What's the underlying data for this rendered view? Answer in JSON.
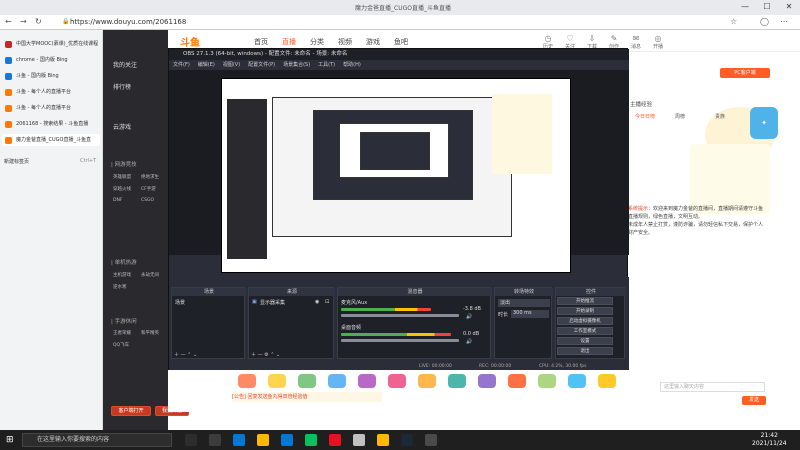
{
  "browser": {
    "window_title": "魔力金爸直播_CUGO直播_斗鱼直播",
    "url": "https://www.douyu.com/2061168",
    "minimize": "—",
    "maximize": "☐",
    "close": "✕"
  },
  "tabs": [
    {
      "label": "中国大学MOOC(慕课)_优质在线课程",
      "color": "#c62828"
    },
    {
      "label": "chrome - 国内版 Bing",
      "color": "#1976d2"
    },
    {
      "label": "斗鱼 - 国内版 Bing",
      "color": "#1976d2"
    },
    {
      "label": "斗鱼 - 每个人的直播平台",
      "color": "#ff7700"
    },
    {
      "label": "斗鱼 - 每个人的直播平台",
      "color": "#ff7700"
    },
    {
      "label": "2061168 - 搜索结果 - 斗鱼直播",
      "color": "#ff7700"
    },
    {
      "label": "魔力金爸直播_CUGO直播_斗鱼直",
      "color": "#ff7700"
    }
  ],
  "new_tab": {
    "label": "新建标签页",
    "shortcut": "Ctrl+T"
  },
  "douyu_sidebar": {
    "items": [
      "我的关注",
      "排行榜",
      "云游戏"
    ],
    "section1": "| 网游竞技",
    "section2": "| 单机热游",
    "section3": "| 手游休闲",
    "sub1": [
      "英雄联盟",
      "绝地求生",
      "穿越火线",
      "CF手游",
      "DNF",
      "CSGO"
    ],
    "sub2": [
      "主机游戏",
      "永劫无间",
      "逆水寒"
    ],
    "sub3": [
      "王者荣耀",
      "和平精英",
      "QQ飞车"
    ],
    "client_btn": "客户端打开",
    "live_btn": "我要开播"
  },
  "douyu_header": {
    "logo": "斗鱼",
    "nav": [
      "首页",
      "直播",
      "分类",
      "视频",
      "游戏",
      "鱼吧"
    ],
    "active_index": 1,
    "icons": [
      {
        "label": "历史",
        "glyph": "◷"
      },
      {
        "label": "关注",
        "glyph": "♡"
      },
      {
        "label": "下载",
        "glyph": "⇩"
      },
      {
        "label": "创作",
        "glyph": "✎"
      },
      {
        "label": "消息",
        "glyph": "✉"
      },
      {
        "label": "开播",
        "glyph": "◎"
      }
    ]
  },
  "douyu_right": {
    "pc_button": "PC客户端",
    "rank_title": "主播经验",
    "rank_tabs": [
      "今日日榜",
      "周榜",
      "贵族"
    ],
    "chat": [
      {
        "sys": "系统提示：",
        "text": "欢迎来到魔力金爸的直播间，直播期间请遵守斗鱼直播规则，绿色直播，文明互动。"
      },
      {
        "sys": "",
        "text": "未成年人禁止打赏，谨防诈骗，请勿轻信私下交易，保护个人财产安全。"
      }
    ],
    "input_placeholder": "这里输入聊天内容",
    "send": "发送"
  },
  "obs": {
    "title": "OBS 27.1.3 (64-bit, windows) - 配置文件: 未命名 - 场景: 未命名",
    "menu": [
      "文件(F)",
      "编辑(E)",
      "视图(V)",
      "配置文件(P)",
      "场景集合(S)",
      "工具(T)",
      "帮助(H)"
    ],
    "panels": {
      "scenes": {
        "title": "场景",
        "items": [
          "场景"
        ]
      },
      "sources": {
        "title": "来源",
        "items": [
          "显示器采集"
        ]
      },
      "mixer": {
        "title": "混音器",
        "tracks": [
          {
            "name": "桌面音频",
            "db": "0.0 dB"
          },
          {
            "name": "麦克风/Aux",
            "db": "-3.8 dB"
          }
        ]
      },
      "transitions": {
        "title": "转场特效",
        "type": "淡出",
        "duration_label": "时长",
        "duration": "300 ms"
      },
      "controls": {
        "title": "控件",
        "buttons": [
          "开始推流",
          "开始录制",
          "启动虚拟摄像机",
          "工作室模式",
          "设置",
          "退出"
        ]
      }
    },
    "status": {
      "live": "LIVE: 00:00:00",
      "rec": "REC: 00:00:00",
      "cpu": "CPU: 4.2%, 30.00 fps"
    }
  },
  "notice": "[公告] 回复发送鱼丸得双倍经验值",
  "taskbar": {
    "search_placeholder": "在这里输入你要搜索的内容",
    "time": "21:42",
    "date": "2021/11/24"
  }
}
